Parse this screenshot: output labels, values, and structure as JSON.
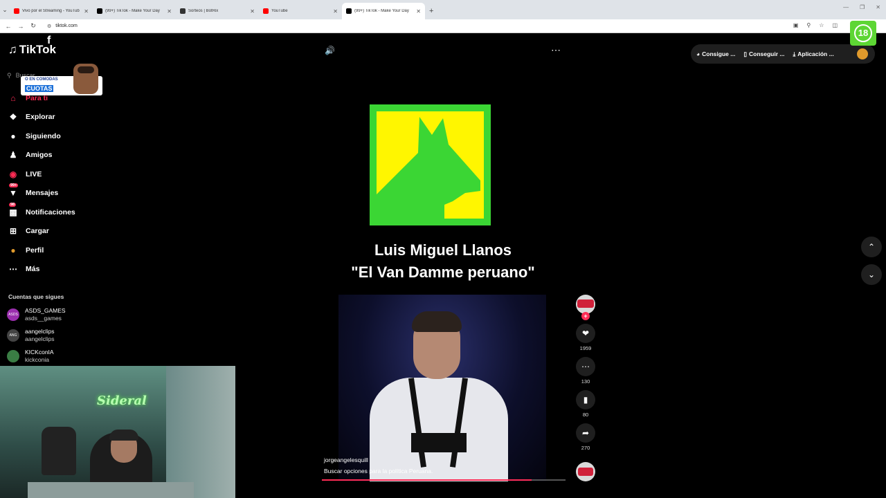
{
  "browser": {
    "tabs": [
      {
        "title": "Vivo por el Streaming - YouTub",
        "favicon_color": "#ff0000",
        "active": false
      },
      {
        "title": "(99+) TikTok - Make Your Day",
        "favicon_color": "#000000",
        "active": false
      },
      {
        "title": "Sorteos | BotRix",
        "favicon_color": "#333333",
        "active": false
      },
      {
        "title": "YouTube",
        "favicon_color": "#ff0000",
        "active": false
      },
      {
        "title": "(99+) TikTok - Make Your Day",
        "favicon_color": "#000000",
        "active": true
      }
    ],
    "new_tab": "+",
    "url": "tiktok.com"
  },
  "age_badge": "18",
  "tiktok": {
    "logo_text": "TikTok",
    "search_placeholder": "Buscar",
    "promo": {
      "line1": "O EN COMODAS",
      "line2": "CUOTAS"
    },
    "nav": [
      {
        "label": "Para ti",
        "icon": "home-icon",
        "active": true
      },
      {
        "label": "Explorar",
        "icon": "compass-icon"
      },
      {
        "label": "Siguiendo",
        "icon": "following-avatar-icon"
      },
      {
        "label": "Amigos",
        "icon": "friends-icon"
      },
      {
        "label": "LIVE",
        "icon": "live-icon"
      },
      {
        "label": "Mensajes",
        "icon": "messages-icon",
        "badge": "99+"
      },
      {
        "label": "Notificaciones",
        "icon": "notifications-icon",
        "badge": "98"
      },
      {
        "label": "Cargar",
        "icon": "upload-icon"
      },
      {
        "label": "Perfil",
        "icon": "profile-icon"
      },
      {
        "label": "Más",
        "icon": "more-icon"
      }
    ],
    "following_title": "Cuentas que sigues",
    "following": [
      {
        "name": "ASDS_GAMES",
        "handle": "asds__games",
        "color": "#9b2fae",
        "av_text": "ASDS"
      },
      {
        "name": "aangelclips",
        "handle": "aangelclips",
        "color": "#444444",
        "av_text": "ANG"
      },
      {
        "name": "KICKconIA",
        "handle": "kickconia",
        "color": "#3a7d44",
        "av_text": ""
      }
    ],
    "webcam_sign": "Sideral",
    "top_pills": [
      {
        "label": "Consigue ...",
        "icon": "coin-icon"
      },
      {
        "label": "Conseguir ...",
        "icon": "phone-icon"
      },
      {
        "label": "Aplicación ...",
        "icon": "download-icon"
      }
    ],
    "video": {
      "title_line1": "Luis Miguel Llanos",
      "title_line2": "\"El  Van Damme  peruano\"",
      "author": "jorgeangelesquill",
      "description": "Buscar opciones para la política Peruana.",
      "progress": 0.86,
      "likes": "1959",
      "comments": "130",
      "saves": "80",
      "shares": "270"
    },
    "colors": {
      "accent": "#fe2c55",
      "dog_bg": "#3bd634",
      "dog_panel": "#fff600"
    }
  }
}
